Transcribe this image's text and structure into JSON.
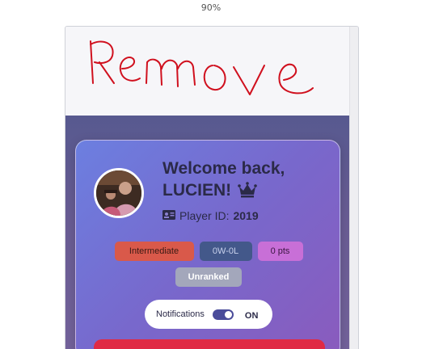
{
  "browser": {
    "zoom_level": "90%"
  },
  "annotation": {
    "handwritten_text": "Remove",
    "stroke_color": "#d0101e"
  },
  "profile": {
    "welcome_line1": "Welcome back,",
    "welcome_name": "LUCIEN!",
    "crown_icon": "crown-icon",
    "player_id_label": "Player ID:",
    "player_id_value": "2019",
    "id_card_icon": "id-card-icon"
  },
  "badges": {
    "level": "Intermediate",
    "record": "0W-0L",
    "points": "0 pts",
    "rank": "Unranked"
  },
  "notifications": {
    "label": "Notifications",
    "state_label": "ON",
    "enabled": true
  },
  "colors": {
    "accent": "#4a4c9a",
    "level_badge": "#d9594a",
    "record_badge": "#43588a",
    "points_badge": "#c86fd7",
    "rank_badge": "#a3a7bb",
    "cta": "#e02a44"
  }
}
